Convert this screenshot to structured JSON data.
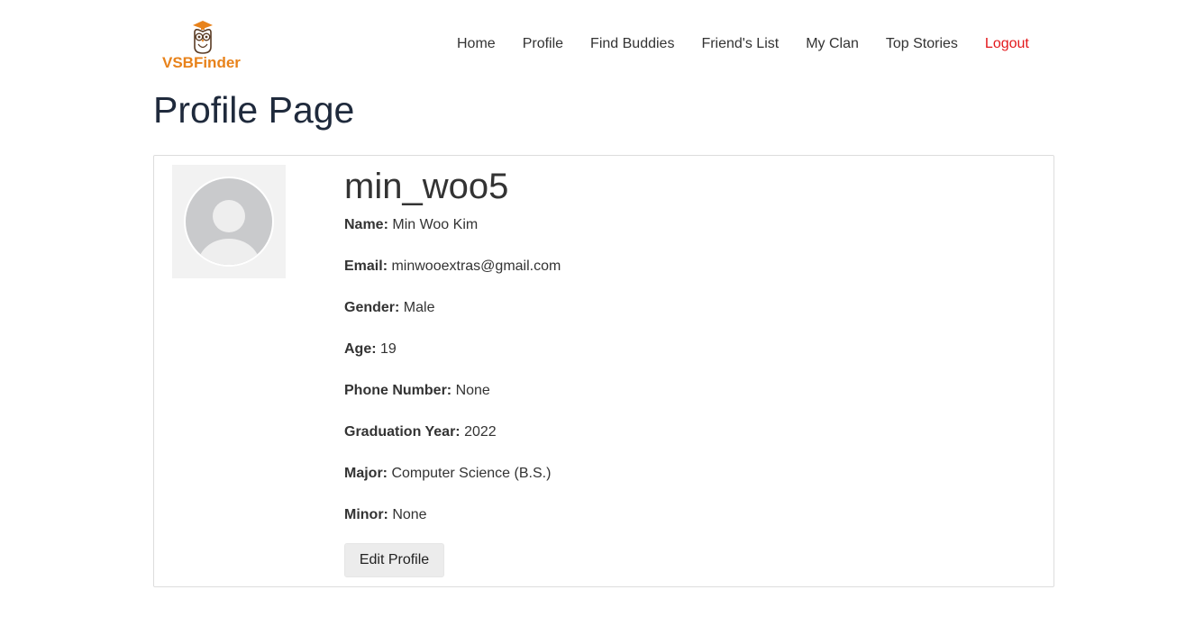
{
  "brand": {
    "name": "VSBFinder",
    "accent_color": "#e8821a",
    "logo_icon": "owl-icon"
  },
  "nav": {
    "items": [
      {
        "label": "Home"
      },
      {
        "label": "Profile"
      },
      {
        "label": "Find Buddies"
      },
      {
        "label": "Friend's List"
      },
      {
        "label": "My Clan"
      },
      {
        "label": "Top Stories"
      }
    ],
    "logout": {
      "label": "Logout",
      "color": "#e3181b"
    }
  },
  "page": {
    "title": "Profile Page"
  },
  "profile": {
    "avatar_icon": "user-avatar-icon",
    "username": "min_woo5",
    "fields": {
      "name": {
        "label": "Name:",
        "value": "Min Woo Kim"
      },
      "email": {
        "label": "Email:",
        "value": "minwooextras@gmail.com"
      },
      "gender": {
        "label": "Gender:",
        "value": "Male"
      },
      "age": {
        "label": "Age:",
        "value": "19"
      },
      "phone": {
        "label": "Phone Number:",
        "value": "None"
      },
      "graduation": {
        "label": "Graduation Year:",
        "value": "2022"
      },
      "major": {
        "label": "Major:",
        "value": "Computer Science (B.S.)"
      },
      "minor": {
        "label": "Minor:",
        "value": "None"
      }
    },
    "edit_button": "Edit Profile"
  }
}
